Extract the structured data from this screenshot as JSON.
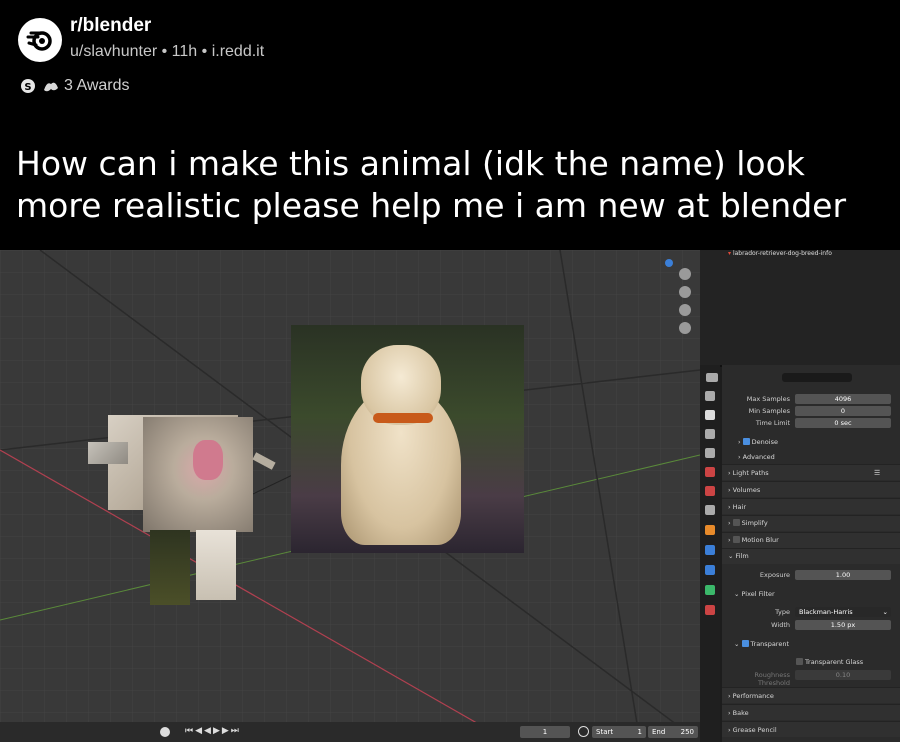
{
  "post": {
    "subreddit": "r/blender",
    "author": "u/slavhunter",
    "age": "11h",
    "domain": "i.redd.it",
    "awards": "3 Awards",
    "title": "How can i make this animal (idk the name) look more realistic please help me i am new at blender"
  },
  "blender": {
    "outliner_item": "labrador-retriever-dog-breed-info",
    "render": {
      "max_samples_label": "Max Samples",
      "max_samples": "4096",
      "min_samples_label": "Min Samples",
      "min_samples": "0",
      "time_limit_label": "Time Limit",
      "time_limit": "0 sec",
      "denoise": "Denoise",
      "advanced": "Advanced",
      "light_paths": "Light Paths",
      "volumes": "Volumes",
      "hair": "Hair",
      "simplify": "Simplify",
      "motion_blur": "Motion Blur",
      "film": "Film",
      "exposure_label": "Exposure",
      "exposure": "1.00",
      "pixel_filter": "Pixel Filter",
      "type_label": "Type",
      "type": "Blackman-Harris",
      "width_label": "Width",
      "width": "1.50 px",
      "transparent": "Transparent",
      "transparent_glass": "Transparent Glass",
      "roughness_label": "Roughness Threshold",
      "roughness": "0.10",
      "performance": "Performance",
      "bake": "Bake",
      "grease_pencil": "Grease Pencil"
    },
    "timeline": {
      "current_frame": "1",
      "start_label": "Start",
      "start": "1",
      "end_label": "End",
      "end": "250"
    }
  },
  "colors": {
    "background": "#000000",
    "viewport": "#393939",
    "panel": "#2b2b2b",
    "accent_blue": "#4a8fe0",
    "collar": "#c85a1a"
  }
}
